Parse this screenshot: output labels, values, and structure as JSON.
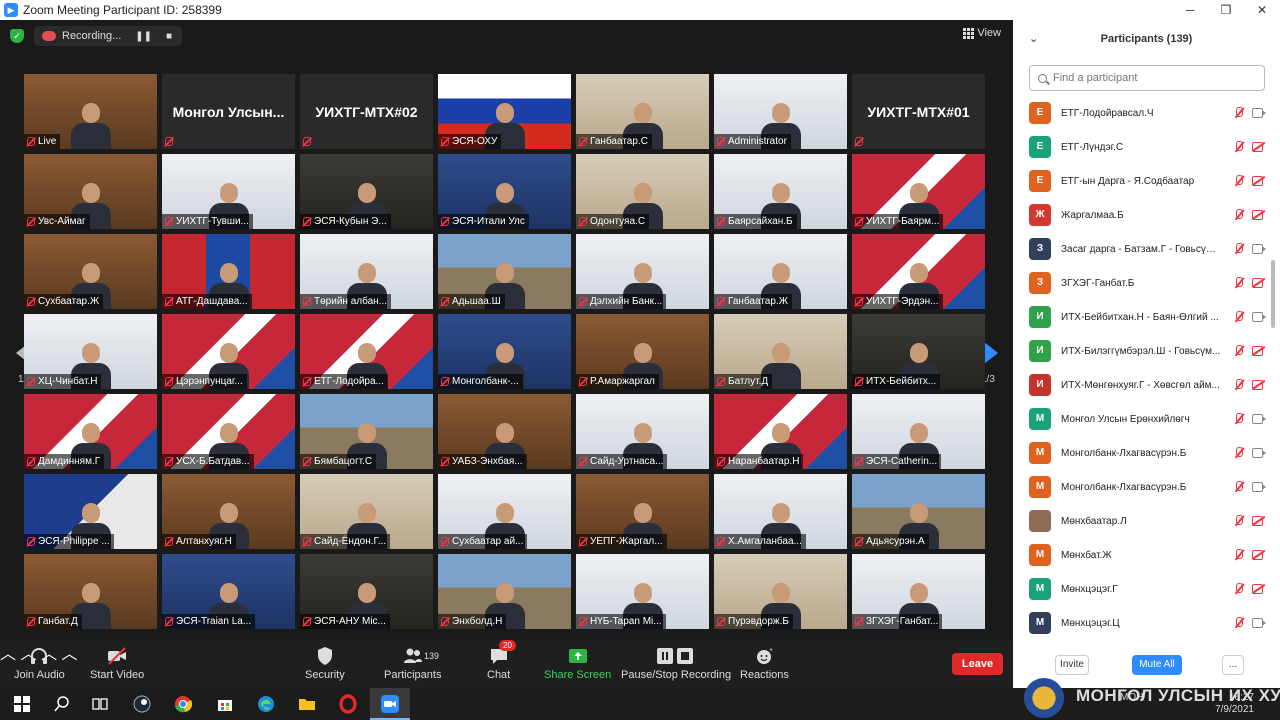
{
  "window": {
    "title": "Zoom Meeting Participant ID: 258399",
    "controls": [
      "─",
      "❐",
      "✕"
    ]
  },
  "topbar": {
    "recording_label": "Recording...",
    "view_label": "View"
  },
  "gallery": {
    "page_left": "1/3",
    "page_right": "1/3",
    "tiles": [
      {
        "name": "Live",
        "bg": "bg-wood",
        "active": true
      },
      {
        "name": "",
        "bigname": "Монгол Улсын...",
        "textonly": true
      },
      {
        "name": "",
        "bigname": "УИХТГ-МТХ#02",
        "textonly": true
      },
      {
        "name": "ЭСЯ-ОХУ",
        "bg": "flag-ru"
      },
      {
        "name": "Ганбаатар.С",
        "bg": "bg-office"
      },
      {
        "name": "Administrator",
        "bg": "bg-light"
      },
      {
        "name": "",
        "bigname": "УИХТГ-МТХ#01",
        "textonly": true
      },
      {
        "name": "Увс-Аймаг",
        "bg": "bg-wood"
      },
      {
        "name": "УИХТГ-Тувши...",
        "bg": "bg-light"
      },
      {
        "name": "ЭСЯ-Кубын Э...",
        "bg": "bg-dark"
      },
      {
        "name": "ЭСЯ-Итали Улс",
        "bg": "bg-blue"
      },
      {
        "name": "Одонтуяа.С",
        "bg": "bg-office"
      },
      {
        "name": "Баярсайхан.Б",
        "bg": "bg-light"
      },
      {
        "name": "УИХТГ-Баярм...",
        "bg": "bg-wave"
      },
      {
        "name": "Сухбаатар.Ж",
        "bg": "bg-wood"
      },
      {
        "name": "АТГ-Дашдава...",
        "bg": "flag-mn"
      },
      {
        "name": "Төрийн албан...",
        "bg": "bg-light"
      },
      {
        "name": "Адьшаа.Ш",
        "bg": "bg-mount"
      },
      {
        "name": "Дэлхийн Банк...",
        "bg": "bg-light"
      },
      {
        "name": "Ганбаатар.Ж",
        "bg": "bg-light"
      },
      {
        "name": "УИХТГ-Эрдэн...",
        "bg": "bg-wave"
      },
      {
        "name": "ХЦ-Чинбат.Н",
        "bg": "bg-light"
      },
      {
        "name": "Цэрэнпунцаг...",
        "bg": "bg-wave"
      },
      {
        "name": "ЕТГ-Лодойра...",
        "bg": "bg-wave"
      },
      {
        "name": "Монголбанк-...",
        "bg": "bg-blue"
      },
      {
        "name": "Р.Амаржаргал",
        "bg": "bg-wood"
      },
      {
        "name": "Батлут.Д",
        "bg": "bg-office"
      },
      {
        "name": "ИТХ-Бейбитх...",
        "bg": "bg-dark"
      },
      {
        "name": "Дамдинням.Г",
        "bg": "bg-wave"
      },
      {
        "name": "УСХ-Б.Батдав...",
        "bg": "bg-wave"
      },
      {
        "name": "Бямбацогт.С",
        "bg": "bg-mount"
      },
      {
        "name": "УАБЗ-Энхбая...",
        "bg": "bg-wood"
      },
      {
        "name": "Сайд-Уртнаса...",
        "bg": "bg-light"
      },
      {
        "name": "Наранбаатар.Н",
        "bg": "bg-wave"
      },
      {
        "name": "ЭСЯ-Catherin...",
        "bg": "bg-light"
      },
      {
        "name": "ЭСЯ-Philippe ...",
        "bg": "bg-eu"
      },
      {
        "name": "Алтанхуяг.Н",
        "bg": "bg-wood"
      },
      {
        "name": "Сайд-Ёндон.Г...",
        "bg": "bg-office"
      },
      {
        "name": "Сухбаатар ай...",
        "bg": "bg-light"
      },
      {
        "name": "УЕПГ-Жаргал...",
        "bg": "bg-wood"
      },
      {
        "name": "Х.Амгаланбаа...",
        "bg": "bg-light"
      },
      {
        "name": "Адьясурэн.А",
        "bg": "bg-mount"
      },
      {
        "name": "Ганбат.Д",
        "bg": "bg-wood"
      },
      {
        "name": "ЭСЯ-Traian La...",
        "bg": "bg-blue"
      },
      {
        "name": "ЭСЯ-АНУ Mic...",
        "bg": "bg-dark"
      },
      {
        "name": "Энхболд.Н",
        "bg": "bg-mount"
      },
      {
        "name": "НҮБ-Tapan Mi...",
        "bg": "bg-light"
      },
      {
        "name": "Пурэвдорж.Б",
        "bg": "bg-office"
      },
      {
        "name": "ЗГХЭГ-Ганбат...",
        "bg": "bg-light"
      }
    ]
  },
  "toolbar": {
    "join_audio": "Join Audio",
    "start_video": "Start Video",
    "security": "Security",
    "participants": "Participants",
    "participants_count": "139",
    "chat": "Chat",
    "chat_badge": "20",
    "share_screen": "Share Screen",
    "pause_recording": "Pause/Stop Recording",
    "reactions": "Reactions",
    "leave": "Leave"
  },
  "panel": {
    "title": "Participants (139)",
    "search_placeholder": "Find a participant",
    "invite": "Invite",
    "mute_all": "Mute All",
    "more": "...",
    "participants": [
      {
        "initial": "Е",
        "name": "ЕТГ-Лодойравсал.Ч",
        "color": "#e0621f",
        "camera_off": false
      },
      {
        "initial": "Е",
        "name": "ЕТГ-Лүндэг.С",
        "color": "#1aa37a",
        "camera_off": true
      },
      {
        "initial": "Е",
        "name": "ЕТГ-ын Дарга - Я.Содбаатар",
        "color": "#e0621f",
        "camera_off": true
      },
      {
        "initial": "Ж",
        "name": "Жаргалмаа.Б",
        "color": "#d0392e",
        "camera_off": true
      },
      {
        "initial": "З",
        "name": "Засаг дарга - Батзам.Г - Говьсүм...",
        "color": "#2f3f5c",
        "camera_off": false
      },
      {
        "initial": "З",
        "name": "ЗГХЭГ-Ганбат.Б",
        "color": "#e0621f",
        "camera_off": true
      },
      {
        "initial": "И",
        "name": "ИТХ-Бейбитхан.Н - Баян-Өлгий ...",
        "color": "#2fa24a",
        "camera_off": false
      },
      {
        "initial": "И",
        "name": "ИТХ-Билэггүмбэрэл.Ш - Говьсүм...",
        "color": "#2fa24a",
        "camera_off": true
      },
      {
        "initial": "И",
        "name": "ИТХ-Мөнгөнхуяг.Г - Хөвсгөл айм...",
        "color": "#c4342c",
        "camera_off": true
      },
      {
        "initial": "М",
        "name": "Монгол Улсын Ерөнхийлөгч",
        "color": "#1aa37a",
        "camera_off": false
      },
      {
        "initial": "М",
        "name": "Монголбанк-Лхагвасүрэн.Б",
        "color": "#e0621f",
        "camera_off": false
      },
      {
        "initial": "М",
        "name": "Монголбанк-Лхагвасүрэн.Б",
        "color": "#e0621f",
        "camera_off": false
      },
      {
        "initial": "",
        "name": "Мөнхбаатар.Л",
        "color": "#8d6b55",
        "camera_off": true
      },
      {
        "initial": "М",
        "name": "Мөнхбат.Ж",
        "color": "#e0621f",
        "camera_off": true
      },
      {
        "initial": "М",
        "name": "Мөнхцэцэг.Г",
        "color": "#1aa37a",
        "camera_off": true
      },
      {
        "initial": "М",
        "name": "Мөнхцэцэг.Ц",
        "color": "#2f3f5c",
        "camera_off": false
      }
    ]
  },
  "watermark": {
    "text": "МОНГОЛ УЛСЫН ИХ ХУРАЛ"
  },
  "taskbar": {
    "lang": "МОН",
    "time": "16:27",
    "date": "7/9/2021"
  }
}
